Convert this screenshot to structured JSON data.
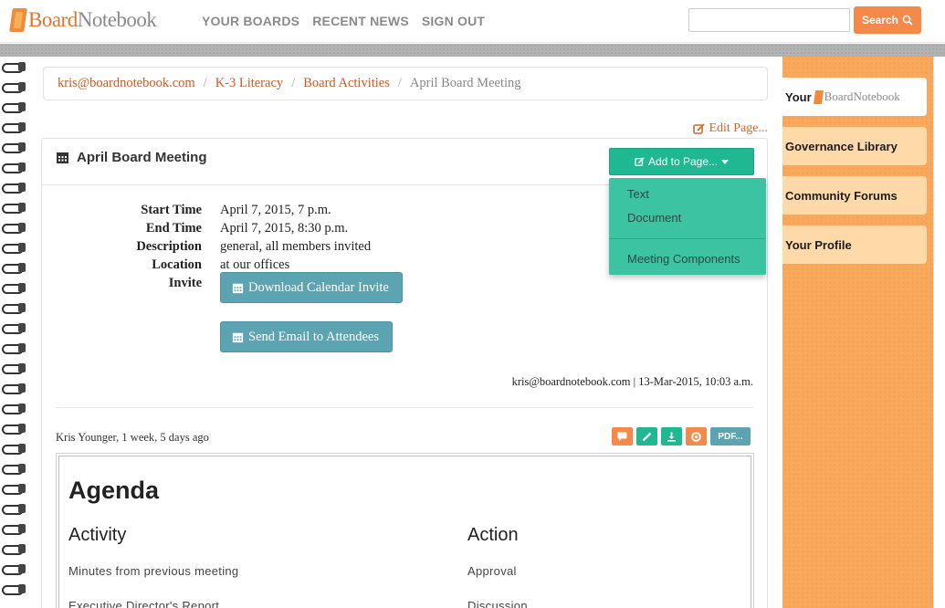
{
  "brand": {
    "logo_prefix": "Board",
    "logo_suffix": "Notebook"
  },
  "nav": {
    "items": [
      "YOUR BOARDS",
      "RECENT NEWS",
      "SIGN OUT"
    ]
  },
  "search": {
    "button_label": "Search",
    "placeholder": ""
  },
  "breadcrumb": {
    "links": [
      "kris@boardnotebook.com",
      "K-3 Literacy",
      "Board Activities"
    ],
    "current": "April Board Meeting",
    "separator": "/"
  },
  "edit_page_label": "Edit Page...",
  "panel": {
    "title": "April Board Meeting",
    "add_button_label": "Add to Page...",
    "dropdown": {
      "items": [
        "Text",
        "Document"
      ],
      "section_item": "Meeting Components"
    }
  },
  "details": {
    "start_time": {
      "label": "Start Time",
      "value": "April 7, 2015, 7 p.m."
    },
    "end_time": {
      "label": "End Time",
      "value": "April 7, 2015, 8:30 p.m."
    },
    "description": {
      "label": "Description",
      "value": "general, all members invited"
    },
    "location": {
      "label": "Location",
      "value": "at our offices"
    },
    "invite": {
      "label": "Invite",
      "download_label": "Download Calendar Invite",
      "email_label": "Send Email to Attendees"
    }
  },
  "meta_line": "kris@boardnotebook.com | 13-Mar-2015, 10:03 a.m.",
  "post": {
    "author_line": "Kris Younger, 1 week, 5 days ago",
    "pdf_label": "PDF...",
    "action_colors": {
      "comment": "#f4894a",
      "edit": "#1fb892",
      "download": "#1fb892",
      "help": "#f4894a"
    }
  },
  "agenda": {
    "title": "Agenda",
    "columns": [
      "Activity",
      "Action"
    ],
    "rows": [
      [
        "Minutes from previous meeting",
        "Approval"
      ],
      [
        "Executive Director's Report",
        "Discussion"
      ]
    ]
  },
  "sidebar": {
    "your_label": "Your",
    "items": [
      "Governance Library",
      "Community Forums",
      "Your Profile"
    ]
  },
  "colors": {
    "accent_orange": "#f4894a",
    "accent_teal": "#1fb892",
    "steel_blue": "#5da4b3",
    "sidebar_orange": "#f8a95c"
  }
}
